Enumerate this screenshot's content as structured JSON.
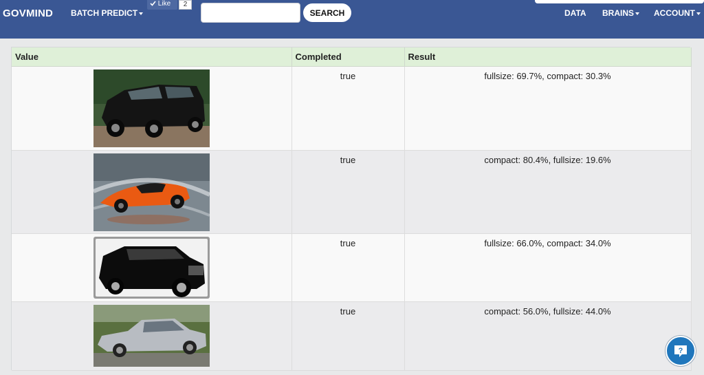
{
  "navbar": {
    "brand": "GOVMIND",
    "batch_predict": "BATCH PREDICT",
    "like_label": "Like",
    "like_count": "2",
    "search_value": "",
    "search_button": "SEARCH",
    "data": "DATA",
    "brains": "BRAINS",
    "account": "ACCOUNT"
  },
  "table": {
    "headers": [
      "Value",
      "Completed",
      "Result"
    ],
    "rows": [
      {
        "image": "black-suv",
        "completed": "true",
        "result": "fullsize: 69.7%, compact: 30.3%"
      },
      {
        "image": "orange-sports-car",
        "completed": "true",
        "result": "compact: 80.4%, fullsize: 19.6%"
      },
      {
        "image": "black-fullsize-suv",
        "completed": "true",
        "result": "fullsize: 66.0%, compact: 34.0%"
      },
      {
        "image": "silver-sedan",
        "completed": "true",
        "result": "compact: 56.0%, fullsize: 44.0%"
      }
    ]
  },
  "colors": {
    "navbar": "#3a5794",
    "header_row": "#dff0d8",
    "help_button": "#1f76bc"
  },
  "help": {
    "icon": "question-icon"
  }
}
